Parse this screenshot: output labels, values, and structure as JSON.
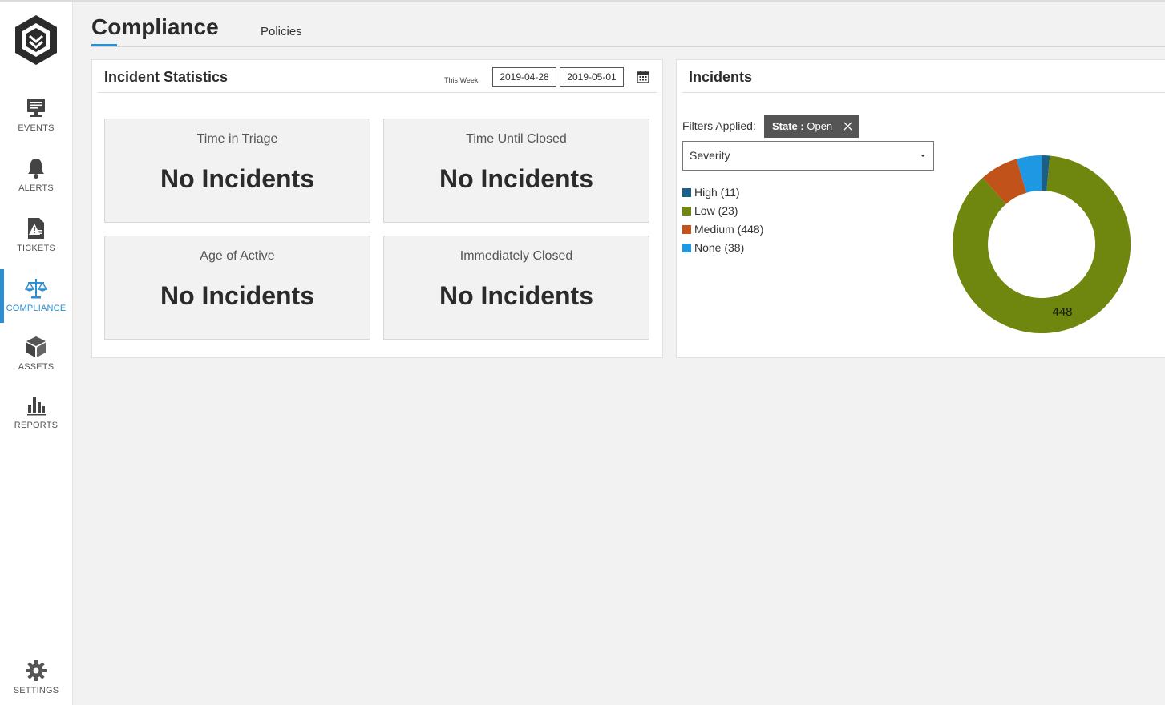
{
  "nav": {
    "items": [
      {
        "label": "EVENTS",
        "icon": "monitor-icon"
      },
      {
        "label": "ALERTS",
        "icon": "bell-icon"
      },
      {
        "label": "TICKETS",
        "icon": "ticket-warning-icon"
      },
      {
        "label": "COMPLIANCE",
        "icon": "scales-icon",
        "active": true
      },
      {
        "label": "ASSETS",
        "icon": "cube-icon"
      },
      {
        "label": "REPORTS",
        "icon": "bar-chart-icon"
      }
    ],
    "settings_label": "SETTINGS"
  },
  "header": {
    "title": "Compliance",
    "tabs": [
      {
        "label": "Policies"
      }
    ]
  },
  "stats": {
    "title": "Incident Statistics",
    "range_label": "This Week",
    "date_start": "2019-04-28",
    "date_end": "2019-05-01",
    "cards": [
      {
        "label": "Time in Triage",
        "value": "No Incidents"
      },
      {
        "label": "Time Until Closed",
        "value": "No Incidents"
      },
      {
        "label": "Age of Active",
        "value": "No Incidents"
      },
      {
        "label": "Immediately Closed",
        "value": "No Incidents"
      }
    ]
  },
  "incidents": {
    "title": "Incidents",
    "filters_label": "Filters Applied:",
    "filter_chip": {
      "key": "State",
      "separator": " : ",
      "value": "Open"
    },
    "group_by": "Severity",
    "legend": [
      {
        "label": "High (11)",
        "color": "#1c5f86"
      },
      {
        "label": "Low (23)",
        "color": "#6f860f"
      },
      {
        "label": "Medium (448)",
        "color": "#c0521a"
      },
      {
        "label": "None (38)",
        "color": "#1f98e3"
      }
    ],
    "donut_label": "448"
  },
  "colors": {
    "accent": "#2a8fd4",
    "high": "#1c5f86",
    "low": "#6f860f",
    "medium": "#c0521a",
    "none": "#1f98e3"
  }
}
